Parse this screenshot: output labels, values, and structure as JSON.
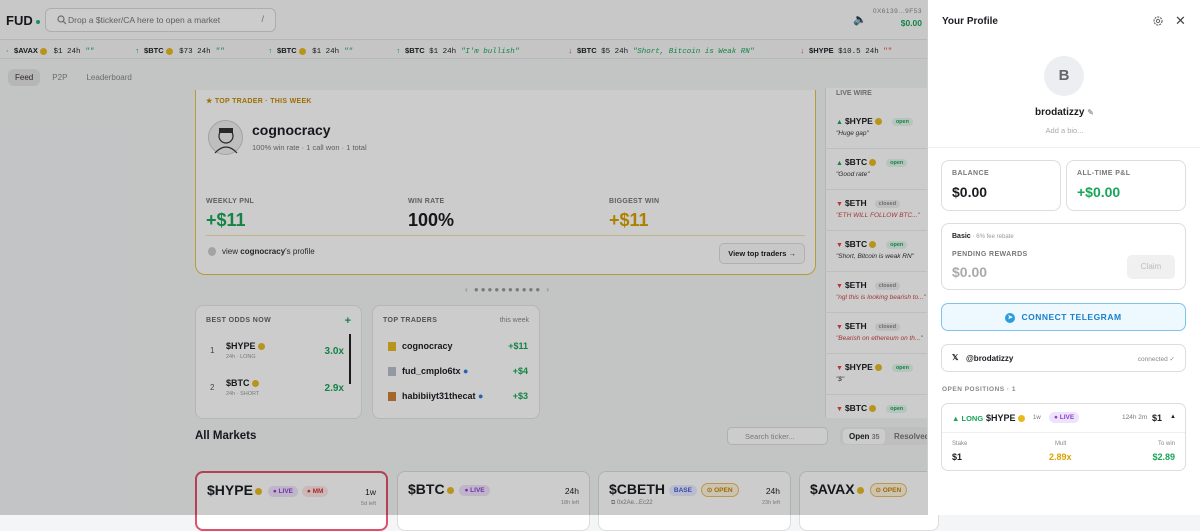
{
  "header": {
    "logo": "FUD",
    "search_placeholder": "Drop a $ticker/CA here to open a market",
    "search_shortcut": "/",
    "wallet_addr": "0X6139...9F53",
    "wallet_balance": "$0.00"
  },
  "ticker": [
    {
      "sym": "$AVAX",
      "amt": "$1",
      "tf": "24h",
      "quote": "\"\"",
      "dir": "up"
    },
    {
      "sym": "$BTC",
      "amt": "$73",
      "tf": "24h",
      "quote": "\"\"",
      "dir": "up"
    },
    {
      "sym": "$BTC",
      "amt": "$1",
      "tf": "24h",
      "quote": "\"\"",
      "dir": "up"
    },
    {
      "sym": "$BTC",
      "amt": "$1",
      "tf": "24h",
      "quote": "\"I'm bullish\"",
      "dir": "up"
    },
    {
      "sym": "$BTC",
      "amt": "$5",
      "tf": "24h",
      "quote": "\"Short, Bitcoin is Weak RN\"",
      "dir": "down"
    },
    {
      "sym": "$HYPE",
      "amt": "$10.5",
      "tf": "24h",
      "quote": "\"\"",
      "dir": "down"
    }
  ],
  "tabs": [
    "Feed",
    "P2P",
    "Leaderboard"
  ],
  "featured": {
    "header": "★ TOP TRADER · THIS WEEK",
    "name": "cognocracy",
    "sub": "100% win rate · 1 call won · 1 total",
    "stats": [
      {
        "label": "WEEKLY PNL",
        "value": "+$11"
      },
      {
        "label": "WIN RATE",
        "value": "100%"
      },
      {
        "label": "BIGGEST WIN",
        "value": "+$11"
      }
    ],
    "view_prefix": "view",
    "view_name": "cognocracy",
    "view_suffix": "'s profile",
    "button": "View top traders →"
  },
  "best_odds": {
    "title": "BEST ODDS NOW",
    "plus": "+",
    "rows": [
      {
        "rank": "1",
        "sym": "$HYPE",
        "meta": "24h · LONG",
        "mult": "3.0x"
      },
      {
        "rank": "2",
        "sym": "$BTC",
        "meta": "24h · SHORT",
        "mult": "2.9x"
      }
    ]
  },
  "top_traders": {
    "title": "TOP TRADERS",
    "period": "this week",
    "rows": [
      {
        "name": "cognocracy",
        "pnl": "+$11"
      },
      {
        "name": "fud_cmplo6tx",
        "pnl": "+$4"
      },
      {
        "name": "habibiiyt31thecat",
        "pnl": "+$3"
      }
    ]
  },
  "markets": {
    "title": "All Markets",
    "search_placeholder": "Search ticker...",
    "open_label": "Open",
    "open_count": "35",
    "resolved_label": "Resolved",
    "cards": [
      {
        "sym": "$HYPE",
        "badges": [
          "● LIVE",
          "● MM"
        ],
        "tf": "1w",
        "time": "5d left"
      },
      {
        "sym": "$BTC",
        "badges": [
          "● LIVE"
        ],
        "tf": "24h",
        "time": "18h left"
      },
      {
        "sym": "$CBETH",
        "badges": [
          "BASE",
          "⊙ OPEN"
        ],
        "tf": "24h",
        "time": "23h left",
        "addr": "⧉ 0x2Ae...Ec22"
      },
      {
        "sym": "$AVAX",
        "badges": [
          "⊙ OPEN"
        ],
        "tf": "",
        "time": ""
      }
    ]
  },
  "feed": {
    "header": "LIVE WIRE",
    "items": [
      {
        "sym": "$HYPE",
        "dir": "up",
        "status": "open",
        "comment": "\"Huge gap\""
      },
      {
        "sym": "$BTC",
        "dir": "up",
        "status": "open",
        "comment": "\"Good rate\""
      },
      {
        "sym": "$ETH",
        "dir": "down",
        "status": "closed",
        "comment": "\"ETH WILL FOLLOW BTC...\""
      },
      {
        "sym": "$BTC",
        "dir": "down",
        "status": "open",
        "comment": "\"Short, Bitcoin is weak RN\""
      },
      {
        "sym": "$ETH",
        "dir": "down",
        "status": "closed",
        "comment": "\"ngl this is looking bearish to...\""
      },
      {
        "sym": "$ETH",
        "dir": "down",
        "status": "closed",
        "comment": "\"Bearish on ethereum on th...\""
      },
      {
        "sym": "$HYPE",
        "dir": "down",
        "status": "open",
        "comment": "\"$\""
      },
      {
        "sym": "$BTC",
        "dir": "down",
        "status": "open",
        "comment": ""
      }
    ]
  },
  "profile": {
    "title": "Your Profile",
    "initial": "B",
    "username": "brodatizzy",
    "bio": "Add a bio...",
    "balance_label": "BALANCE",
    "balance": "$0.00",
    "pnl_label": "ALL-TIME P&L",
    "pnl": "+$0.00",
    "tier": "Basic",
    "tier_note": "· 6% fee rebate",
    "pending_label": "PENDING REWARDS",
    "pending": "$0.00",
    "claim": "Claim",
    "telegram": "CONNECT TELEGRAM",
    "x_icon": "𝕏",
    "x_handle": "@brodatizzy",
    "x_status": "connected ✓",
    "open_positions": "OPEN POSITIONS · 1",
    "position": {
      "side": "▲ LONG",
      "sym": "$HYPE",
      "tf": "1w",
      "live": "● LIVE",
      "time": "124h 2m",
      "amount": "$1",
      "stake_label": "Stake",
      "stake": "$1",
      "mult_label": "Mult",
      "mult": "2.89x",
      "win_label": "To win",
      "win": "$2.89"
    }
  },
  "colors": {
    "green": "#18a558",
    "gold": "#e3c34a",
    "red": "#e84040"
  }
}
